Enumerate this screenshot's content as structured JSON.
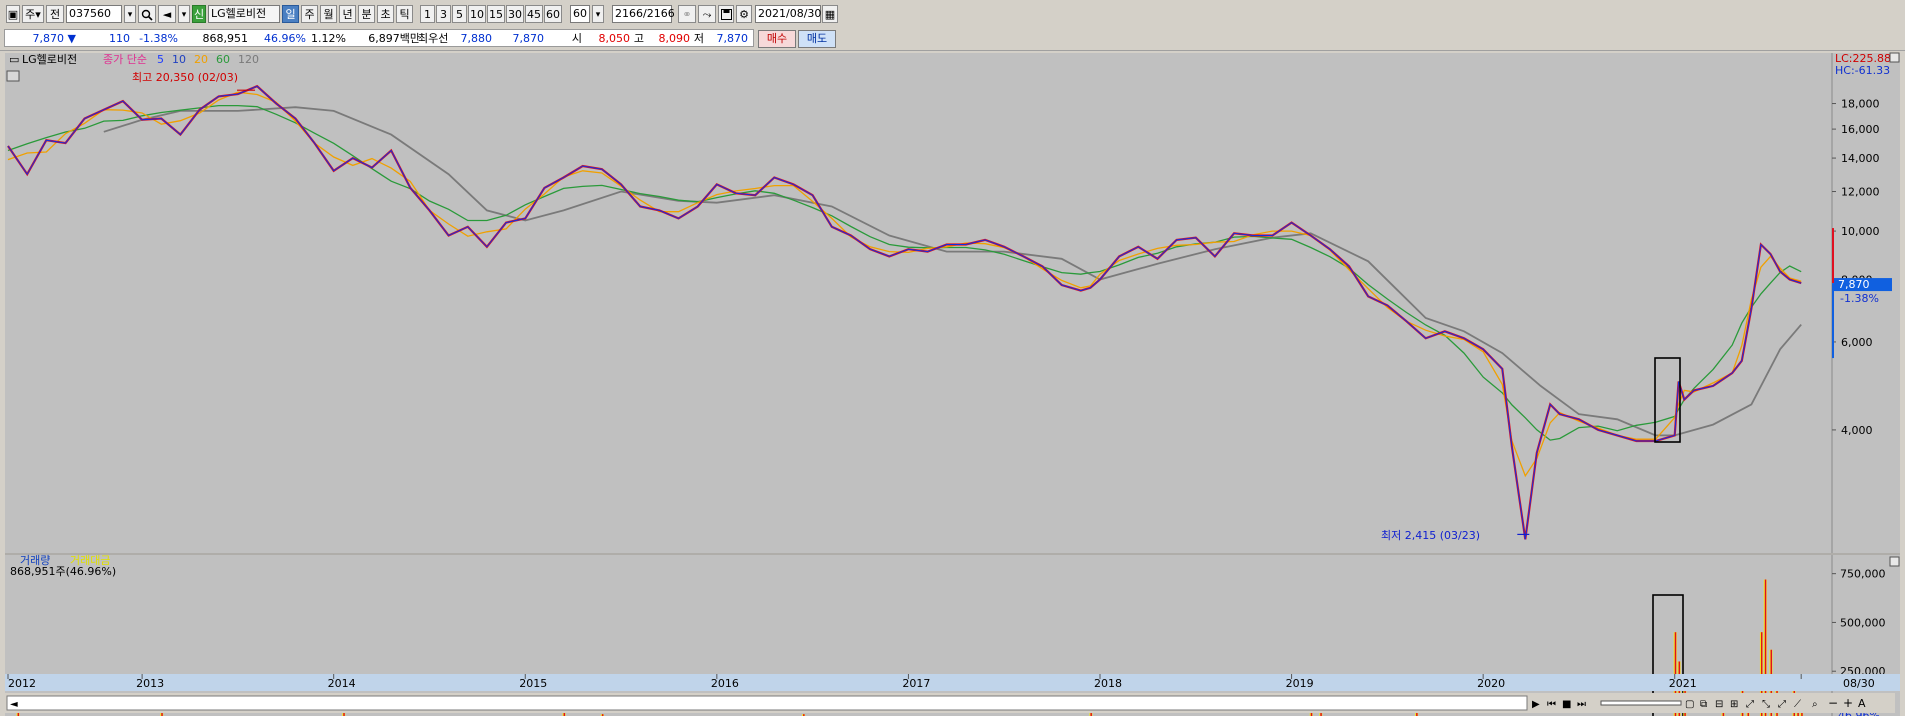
{
  "toolbar": {
    "market": "주",
    "period_type": "전",
    "code": "037560",
    "stock_name": "LG헬로비전",
    "badge_new": "신",
    "periods": [
      "일",
      "주",
      "월",
      "년",
      "분",
      "초",
      "틱"
    ],
    "active_period": "일",
    "nums": [
      "1",
      "3",
      "5",
      "10",
      "15",
      "30",
      "45",
      "60"
    ],
    "nums_value": "60",
    "count": "2166",
    "total": "/2166",
    "date": "2021/08/30"
  },
  "quote": {
    "price": "7,870",
    "change": "110",
    "change_pct": "-1.38%",
    "volume": "868,951",
    "vol_ratio": "46.96%",
    "turnover": "1.12%",
    "amount": "6,897백만",
    "best_label": "최우선",
    "ask": "7,880",
    "bid": "7,870",
    "open_label": "시",
    "open": "8,050",
    "high_label": "고",
    "high": "8,090",
    "low_label": "저",
    "low": "7,870",
    "buy_btn": "매수",
    "sell_btn": "매도"
  },
  "chart_data": {
    "type": "line",
    "title": "LG헬로비전",
    "legend": {
      "prefix": "종가 단순",
      "items": [
        {
          "label": "5",
          "color": "#1e3cff"
        },
        {
          "label": "10",
          "color": "#2040c0"
        },
        {
          "label": "20",
          "color": "#f0a000"
        },
        {
          "label": "60",
          "color": "#2a9a3a"
        },
        {
          "label": "120",
          "color": "#7a7a7a"
        }
      ]
    },
    "scale_info": {
      "lc": "LC:225.88",
      "hc": "HC:-61.33"
    },
    "y_ticks": [
      "18,000",
      "16,000",
      "14,000",
      "12,000",
      "10,000",
      "8,000",
      "6,000",
      "4,000"
    ],
    "y_tick_values": [
      18000,
      16000,
      14000,
      12000,
      10000,
      8000,
      6000,
      4000
    ],
    "ylim": [
      2300,
      22000
    ],
    "x_labels": [
      "2012",
      "2013",
      "2014",
      "2015",
      "2016",
      "2017",
      "2018",
      "2019",
      "2020",
      "2021",
      "08/30"
    ],
    "x_label_years": [
      2012.3,
      2013.0,
      2014.0,
      2015.0,
      2016.0,
      2017.0,
      2018.0,
      2019.0,
      2020.0,
      2021.0,
      2021.66
    ],
    "xlim": [
      2012.3,
      2021.8
    ],
    "price_series": [
      [
        2012.3,
        14800
      ],
      [
        2012.4,
        13000
      ],
      [
        2012.5,
        15200
      ],
      [
        2012.6,
        15000
      ],
      [
        2012.7,
        16800
      ],
      [
        2012.8,
        17500
      ],
      [
        2012.9,
        18200
      ],
      [
        2013.0,
        16700
      ],
      [
        2013.1,
        16800
      ],
      [
        2013.2,
        15600
      ],
      [
        2013.3,
        17500
      ],
      [
        2013.4,
        18600
      ],
      [
        2013.5,
        18800
      ],
      [
        2013.6,
        19500
      ],
      [
        2013.7,
        18000
      ],
      [
        2013.8,
        16800
      ],
      [
        2013.9,
        15000
      ],
      [
        2014.0,
        13200
      ],
      [
        2014.1,
        14000
      ],
      [
        2014.2,
        13400
      ],
      [
        2014.3,
        14500
      ],
      [
        2014.4,
        12200
      ],
      [
        2014.5,
        11000
      ],
      [
        2014.6,
        9800
      ],
      [
        2014.7,
        10200
      ],
      [
        2014.8,
        9300
      ],
      [
        2014.9,
        10400
      ],
      [
        2015.0,
        10600
      ],
      [
        2015.1,
        12200
      ],
      [
        2015.2,
        12800
      ],
      [
        2015.3,
        13500
      ],
      [
        2015.4,
        13300
      ],
      [
        2015.5,
        12400
      ],
      [
        2015.6,
        11200
      ],
      [
        2015.7,
        11000
      ],
      [
        2015.8,
        10600
      ],
      [
        2015.9,
        11200
      ],
      [
        2016.0,
        12400
      ],
      [
        2016.1,
        11900
      ],
      [
        2016.2,
        11800
      ],
      [
        2016.3,
        12800
      ],
      [
        2016.4,
        12400
      ],
      [
        2016.5,
        11800
      ],
      [
        2016.6,
        10200
      ],
      [
        2016.7,
        9800
      ],
      [
        2016.8,
        9200
      ],
      [
        2016.9,
        8900
      ],
      [
        2017.0,
        9200
      ],
      [
        2017.1,
        9100
      ],
      [
        2017.2,
        9400
      ],
      [
        2017.3,
        9400
      ],
      [
        2017.4,
        9600
      ],
      [
        2017.5,
        9300
      ],
      [
        2017.6,
        8900
      ],
      [
        2017.7,
        8500
      ],
      [
        2017.8,
        7800
      ],
      [
        2017.9,
        7600
      ],
      [
        2017.95,
        7700
      ],
      [
        2018.0,
        8000
      ],
      [
        2018.1,
        8900
      ],
      [
        2018.2,
        9300
      ],
      [
        2018.3,
        8800
      ],
      [
        2018.4,
        9600
      ],
      [
        2018.5,
        9700
      ],
      [
        2018.6,
        8900
      ],
      [
        2018.7,
        9900
      ],
      [
        2018.8,
        9800
      ],
      [
        2018.9,
        9800
      ],
      [
        2019.0,
        10400
      ],
      [
        2019.1,
        9800
      ],
      [
        2019.2,
        9200
      ],
      [
        2019.3,
        8500
      ],
      [
        2019.4,
        7400
      ],
      [
        2019.5,
        7100
      ],
      [
        2019.6,
        6600
      ],
      [
        2019.7,
        6100
      ],
      [
        2019.8,
        6300
      ],
      [
        2019.9,
        6100
      ],
      [
        2020.0,
        5800
      ],
      [
        2020.1,
        5300
      ],
      [
        2020.15,
        3700
      ],
      [
        2020.22,
        2415
      ],
      [
        2020.28,
        3600
      ],
      [
        2020.35,
        4500
      ],
      [
        2020.4,
        4300
      ],
      [
        2020.5,
        4200
      ],
      [
        2020.6,
        4000
      ],
      [
        2020.7,
        3900
      ],
      [
        2020.8,
        3800
      ],
      [
        2020.9,
        3800
      ],
      [
        2021.0,
        3900
      ],
      [
        2021.02,
        5000
      ],
      [
        2021.05,
        4600
      ],
      [
        2021.1,
        4800
      ],
      [
        2021.2,
        4900
      ],
      [
        2021.3,
        5200
      ],
      [
        2021.35,
        5500
      ],
      [
        2021.4,
        7000
      ],
      [
        2021.45,
        9400
      ],
      [
        2021.5,
        9000
      ],
      [
        2021.55,
        8300
      ],
      [
        2021.6,
        8000
      ],
      [
        2021.66,
        7870
      ]
    ],
    "ma_gray_series": [
      [
        2012.8,
        15800
      ],
      [
        2013.0,
        16700
      ],
      [
        2013.2,
        17400
      ],
      [
        2013.5,
        17400
      ],
      [
        2013.8,
        17700
      ],
      [
        2014.0,
        17400
      ],
      [
        2014.3,
        15600
      ],
      [
        2014.6,
        13000
      ],
      [
        2014.8,
        11000
      ],
      [
        2015.0,
        10500
      ],
      [
        2015.2,
        11000
      ],
      [
        2015.5,
        12000
      ],
      [
        2015.8,
        11500
      ],
      [
        2016.0,
        11400
      ],
      [
        2016.3,
        11800
      ],
      [
        2016.6,
        11200
      ],
      [
        2016.9,
        9800
      ],
      [
        2017.2,
        9100
      ],
      [
        2017.5,
        9100
      ],
      [
        2017.8,
        8800
      ],
      [
        2018.0,
        8000
      ],
      [
        2018.3,
        8600
      ],
      [
        2018.6,
        9200
      ],
      [
        2018.9,
        9700
      ],
      [
        2019.1,
        9900
      ],
      [
        2019.4,
        8700
      ],
      [
        2019.7,
        6700
      ],
      [
        2019.9,
        6300
      ],
      [
        2020.1,
        5700
      ],
      [
        2020.3,
        4900
      ],
      [
        2020.5,
        4300
      ],
      [
        2020.7,
        4200
      ],
      [
        2020.9,
        3900
      ],
      [
        2021.0,
        3900
      ],
      [
        2021.2,
        4100
      ],
      [
        2021.4,
        4500
      ],
      [
        2021.55,
        5800
      ],
      [
        2021.66,
        6500
      ]
    ],
    "annotations": {
      "high_label": "최고 20,350 (02/03)",
      "low_label": "최저 2,415 (03/23)",
      "last_price": "7,870",
      "last_change": "-1.38%"
    },
    "volume": {
      "title": "거래량",
      "title2": "거래대금",
      "current": "868,951주(46.96%)",
      "y_ticks": [
        "750,000",
        "500,000",
        "250,000"
      ],
      "y_tick_values": [
        750000,
        500000,
        250000
      ],
      "ylim": [
        0,
        820000
      ],
      "last_volume": "868,951",
      "last_pct": "46.96%",
      "bars": [
        [
          2012.35,
          60000
        ],
        [
          2013.1,
          70000
        ],
        [
          2014.05,
          40000
        ],
        [
          2015.2,
          60000
        ],
        [
          2015.4,
          30000
        ],
        [
          2016.45,
          30000
        ],
        [
          2017.95,
          40000
        ],
        [
          2019.1,
          90000
        ],
        [
          2019.15,
          60000
        ],
        [
          2019.65,
          80000
        ],
        [
          2021.0,
          450000
        ],
        [
          2021.02,
          300000
        ],
        [
          2021.05,
          150000
        ],
        [
          2021.25,
          60000
        ],
        [
          2021.35,
          170000
        ],
        [
          2021.38,
          120000
        ],
        [
          2021.45,
          450000
        ],
        [
          2021.47,
          720000
        ],
        [
          2021.5,
          360000
        ],
        [
          2021.53,
          200000
        ],
        [
          2021.62,
          210000
        ],
        [
          2021.64,
          120000
        ],
        [
          2021.66,
          70000
        ]
      ]
    }
  }
}
